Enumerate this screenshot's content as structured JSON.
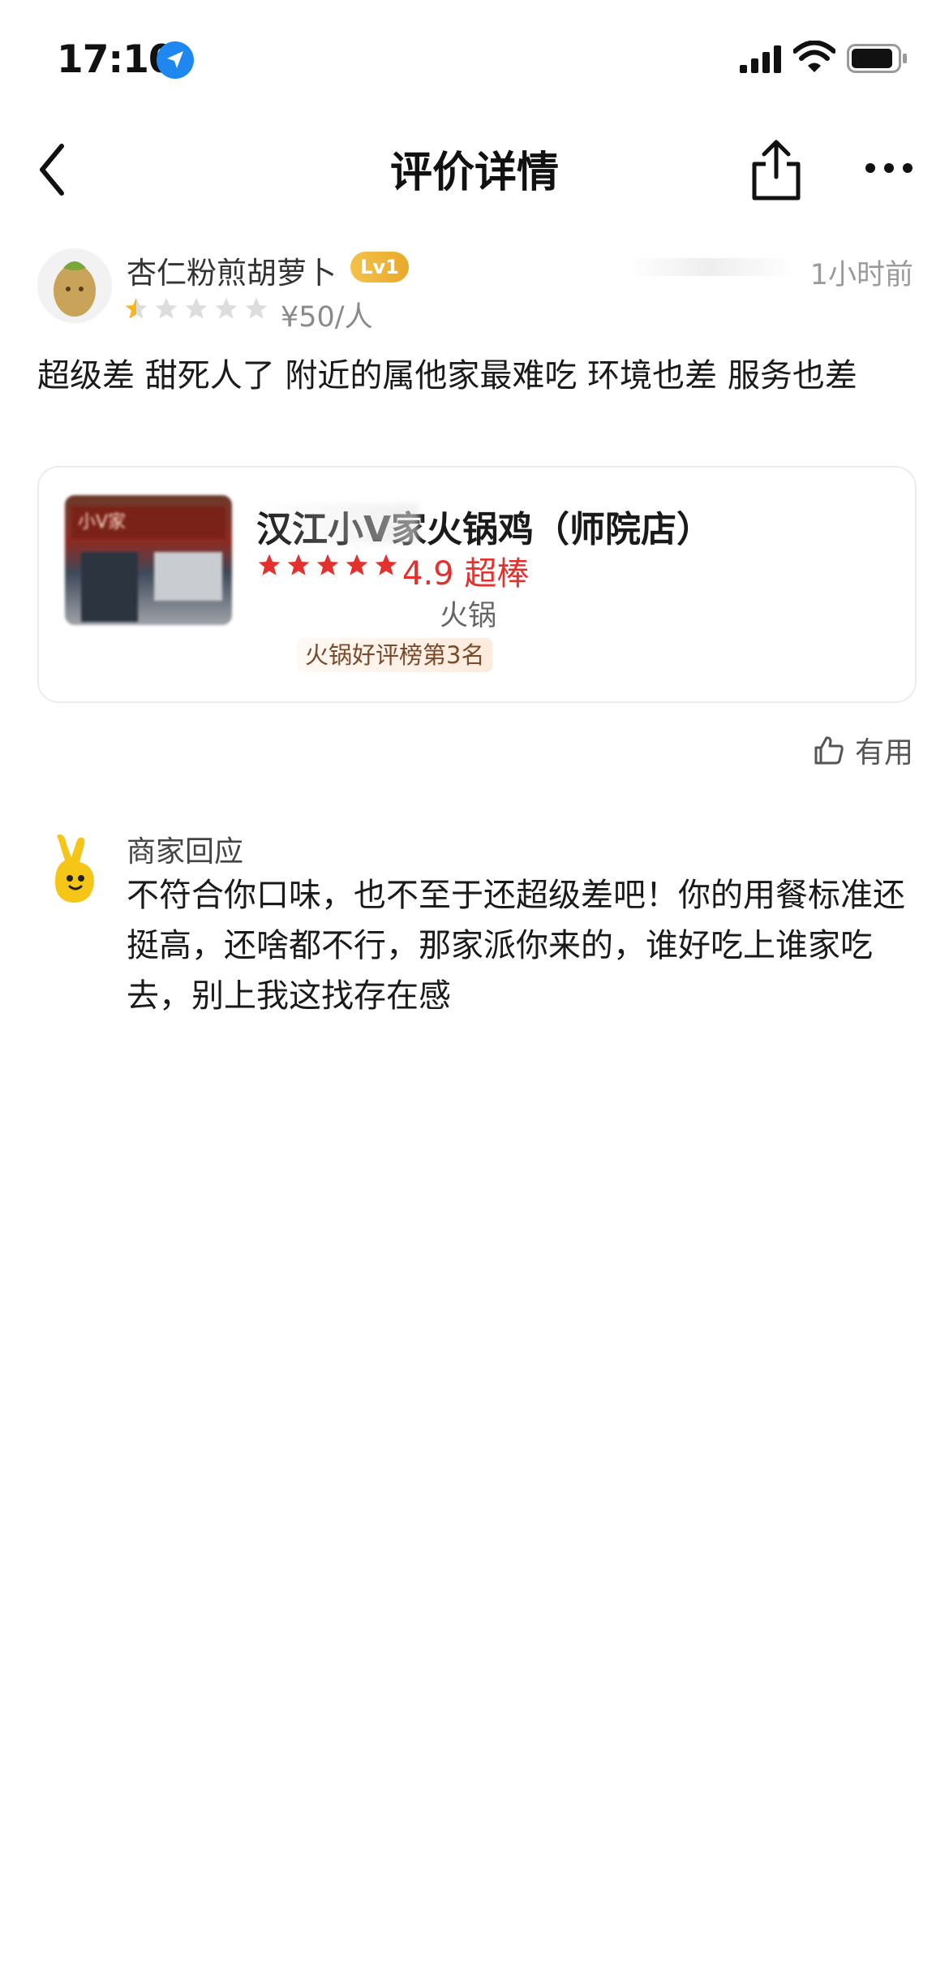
{
  "status_bar": {
    "time": "17:10"
  },
  "nav": {
    "title": "评价详情"
  },
  "review": {
    "username": "杏仁粉煎胡萝卜",
    "level": "Lv1",
    "time_ago": "1小时前",
    "rating_stars": 0.5,
    "price": "¥50/人",
    "text": "超级差  甜死人了 附近的属他家最难吃 环境也差 服务也差"
  },
  "shop": {
    "name": "汉江小V家火锅鸡（师院店）",
    "rating_stars": 5,
    "rating_text": "4.9 超棒",
    "category": "火锅",
    "rank": "火锅好评榜第3名",
    "photo_sign": "小V家"
  },
  "helpful": {
    "label": "有用"
  },
  "merchant_reply": {
    "title": "商家回应",
    "text": "不符合你口味，也不至于还超级差吧！你的用餐标准还挺高，还啥都不行，那家派你来的，谁好吃上谁家吃去，别上我这找存在感"
  },
  "colors": {
    "accent_red": "#e3312d",
    "star_gray": "#dddddd",
    "star_gold": "#f2b721",
    "level_gold": "#f0b53a",
    "location_blue": "#1e88f0"
  },
  "icons": [
    "location-arrow-icon",
    "signal-icon",
    "wifi-icon",
    "battery-icon",
    "back-icon",
    "share-icon",
    "more-icon",
    "thumbs-up-icon",
    "merchant-mascot-icon"
  ]
}
